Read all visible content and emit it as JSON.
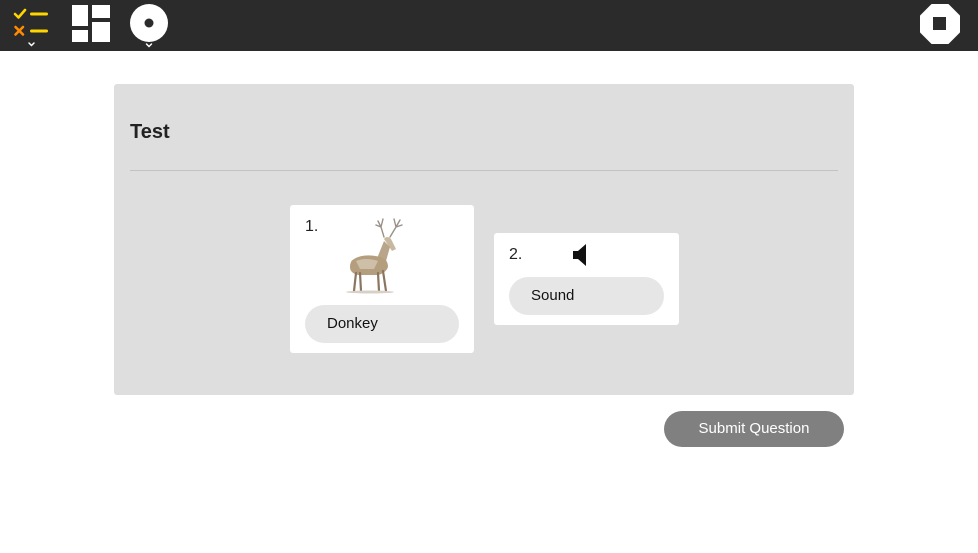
{
  "toolbar": {
    "items": [
      {
        "name": "activity-list-button",
        "icon": "checklist-icon"
      },
      {
        "name": "layout-grid-button",
        "icon": "grid-icon"
      },
      {
        "name": "record-button",
        "icon": "circle-dot-icon"
      },
      {
        "name": "stop-button",
        "icon": "stop-icon"
      }
    ],
    "colors": {
      "background": "#2b2b2b",
      "check": "#ffd500",
      "cross": "#ff8c00",
      "icon": "#ffffff"
    }
  },
  "main": {
    "title": "Test",
    "questions": [
      {
        "number": "1.",
        "media": "deer-image",
        "answer": "Donkey"
      },
      {
        "number": "2.",
        "media": "speaker-icon",
        "answer": "Sound"
      }
    ],
    "submit_label": "Submit Question"
  }
}
